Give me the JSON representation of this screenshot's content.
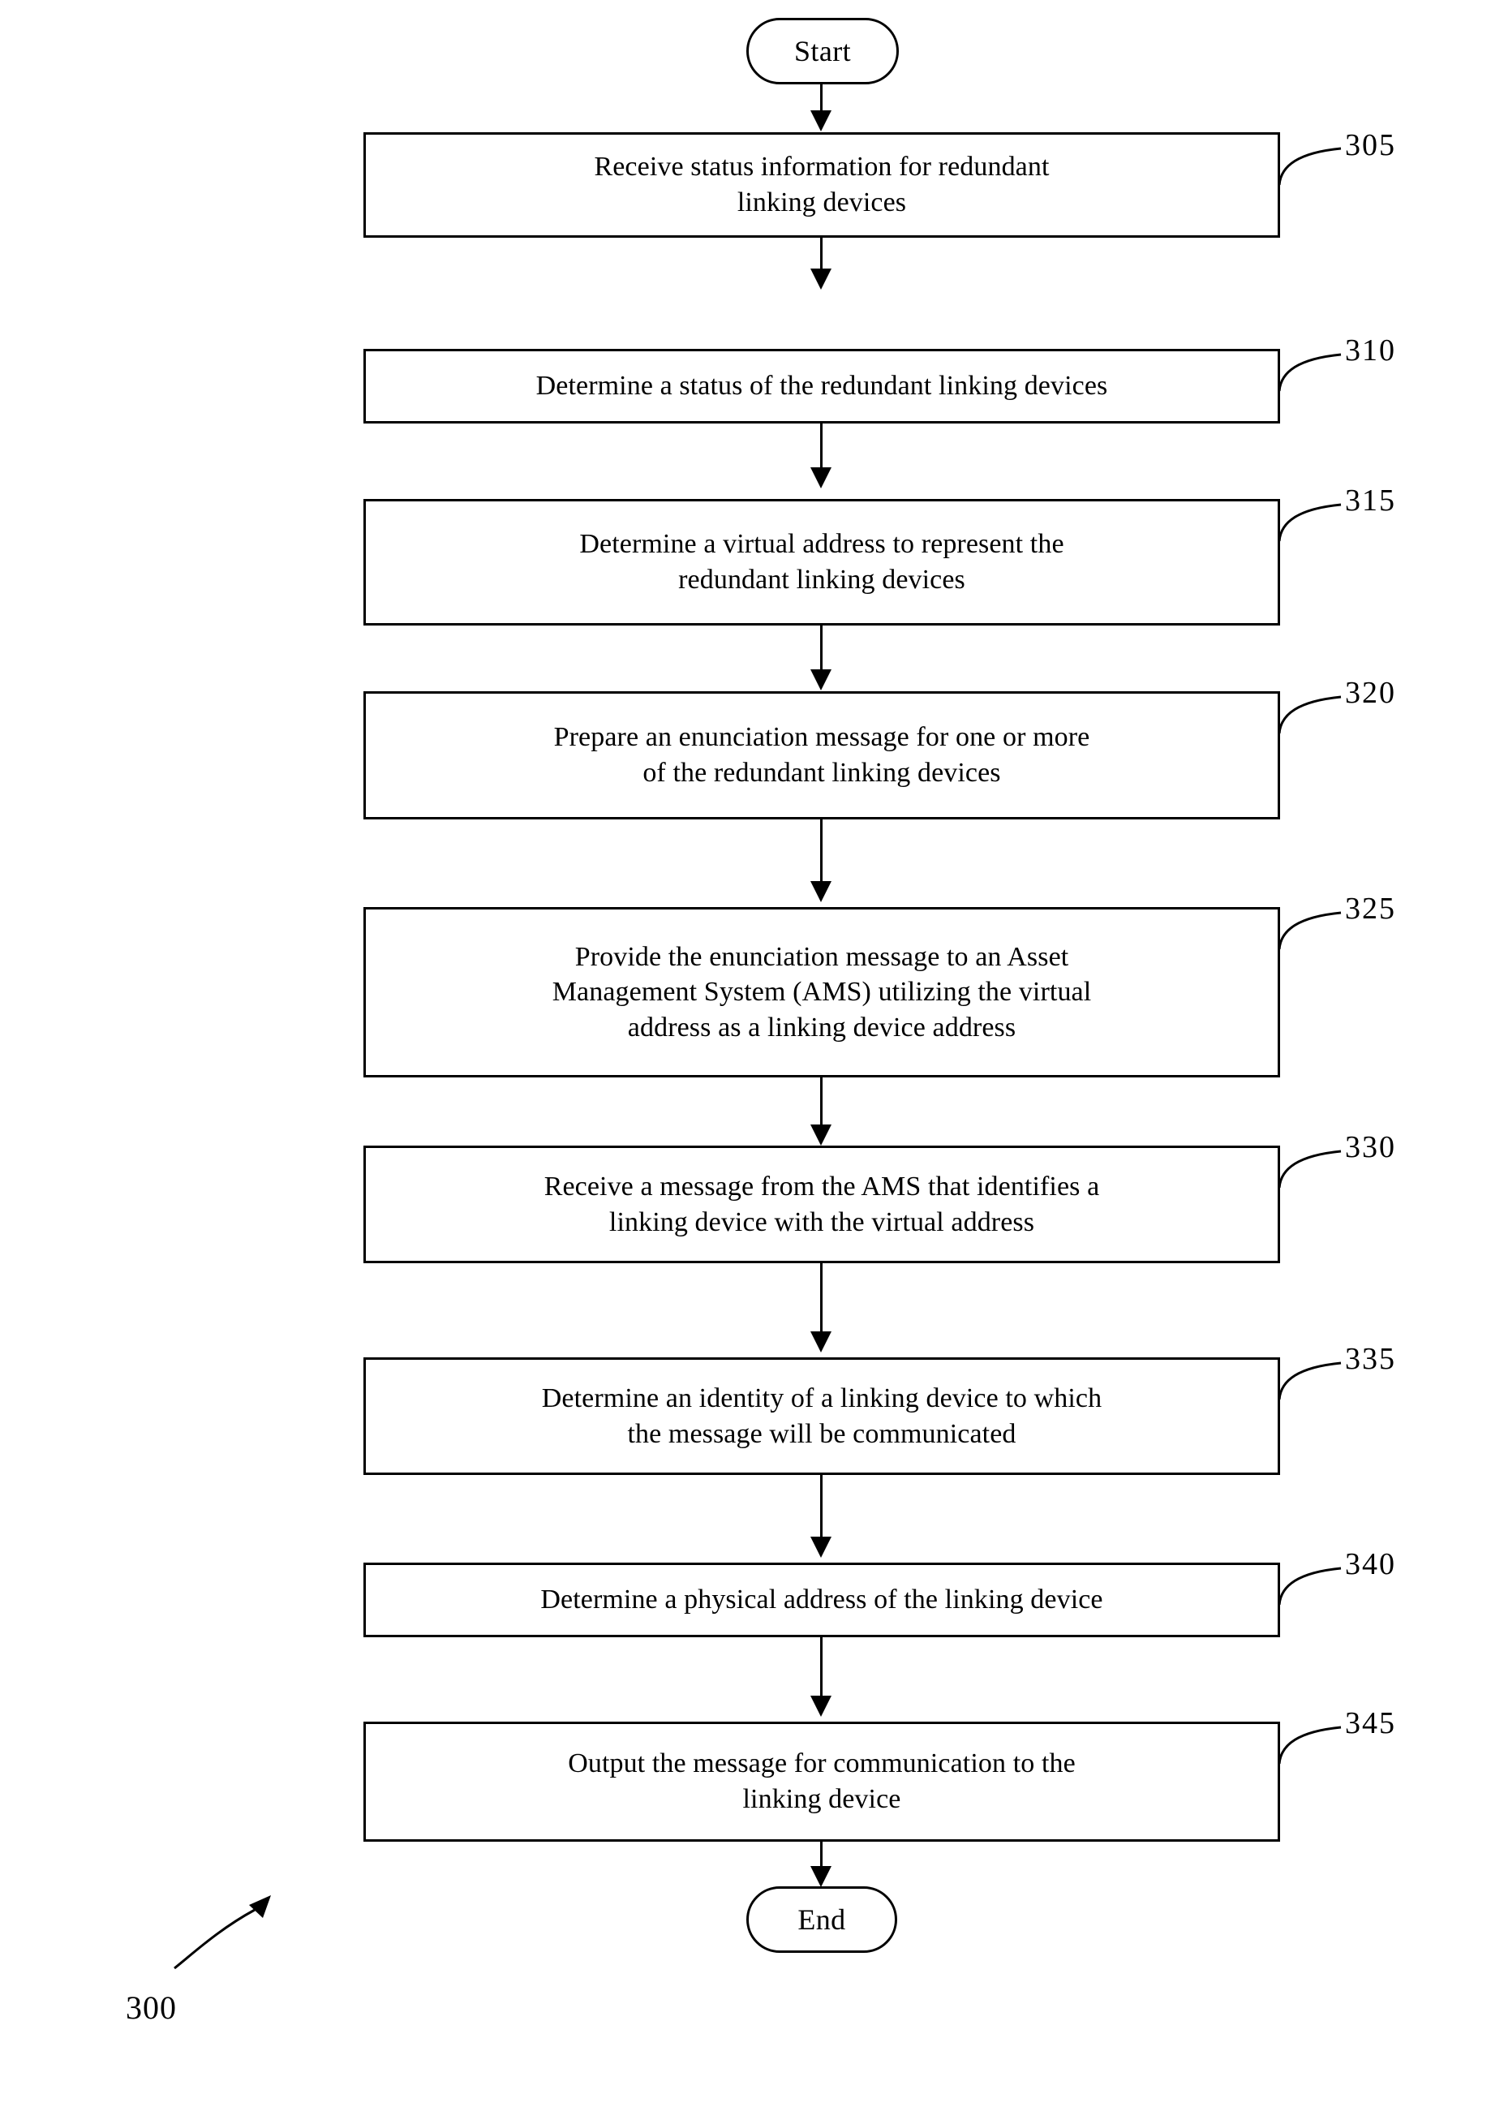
{
  "figure": {
    "label": "300",
    "start_label": "Start",
    "end_label": "End"
  },
  "steps": [
    {
      "ref": "305",
      "text": "Receive status information for redundant\nlinking devices",
      "lines": 2
    },
    {
      "ref": "310",
      "text": "Determine a status of the redundant linking devices",
      "lines": 1
    },
    {
      "ref": "315",
      "text": "Determine a virtual address to represent the\nredundant linking devices",
      "lines": 2
    },
    {
      "ref": "320",
      "text": "Prepare an enunciation message for one or more\nof the redundant linking devices",
      "lines": 2
    },
    {
      "ref": "325",
      "text": "Provide the enunciation message to an Asset\nManagement System (AMS) utilizing the virtual\naddress as a linking device address",
      "lines": 3
    },
    {
      "ref": "330",
      "text": "Receive a message from the AMS that identifies a\nlinking device with the virtual address",
      "lines": 2
    },
    {
      "ref": "335",
      "text": "Determine an identity of a linking device to which\nthe message will be communicated",
      "lines": 2
    },
    {
      "ref": "340",
      "text": "Determine a physical address of the linking device",
      "lines": 1
    },
    {
      "ref": "345",
      "text": "Output the message for communication to the\nlinking device",
      "lines": 2
    }
  ],
  "colors": {
    "stroke": "#000000",
    "background": "#ffffff"
  }
}
